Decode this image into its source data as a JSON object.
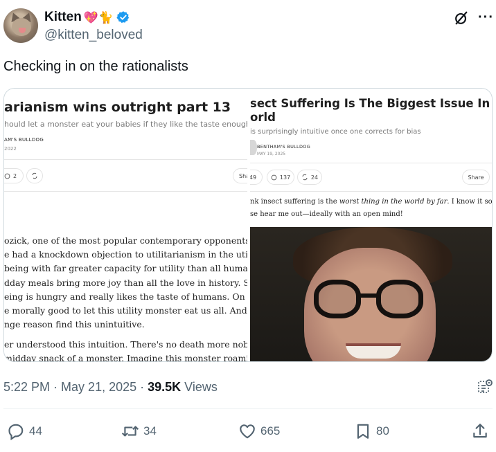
{
  "author": {
    "display_name": "Kitten",
    "emoji": "💖🐈",
    "handle": "@kitten_beloved"
  },
  "tweet": {
    "text": "Checking in on the rationalists"
  },
  "media": {
    "left": {
      "title": "arianism wins outright part 13",
      "subtitle": "hould let a monster eat your babies if they like the taste enough",
      "author": "AM'S BULLDOG",
      "date": "2022",
      "comment_count": "2",
      "share_label": "Sha",
      "body_lines": [
        "ozick, one of the most popular contemporary opponents of utilitaria",
        "e had a knockdown objection to utilitarianism in the utility monster",
        " being with far greater capacity for utility than all humans in history",
        "dday meals bring more joy than all the love in history. Suppose addi",
        "eing is hungry and really likes the taste of humans. On utilitarian a",
        "e morally good to let this utility monster eat us all. And yet some pe",
        "nge reason find this unintuitive.",
        "er understood this intuition. There's no death more noble than dyin",
        "midday snack of a monster. Imagine this monster roaming around, e"
      ]
    },
    "right": {
      "title_line1": "sect Suffering Is The Biggest Issue In The",
      "title_line2": "orld",
      "subtitle": "is surprisingly intuitive once one corrects for bias",
      "author": "BENTHAM'S BULLDOG",
      "date": "MAY 19, 2025",
      "likes": "49",
      "comments": "137",
      "restacks": "24",
      "share_label": "Share",
      "body_line1_pre": "nk insect suffering is the ",
      "body_line1_em": "worst thing in the world by far",
      "body_line1_post": ". I know it sounds weird!",
      "body_line2": "se hear me out—ideally with an open mind!"
    }
  },
  "meta": {
    "time": "5:22 PM",
    "separator": "·",
    "date": "May 21, 2025",
    "views_count": "39.5K",
    "views_label": "Views"
  },
  "actions": {
    "replies": "44",
    "reposts": "34",
    "likes": "665",
    "bookmarks": "80"
  },
  "colors": {
    "verified": "#1d9bf0",
    "secondary_text": "#536471",
    "primary_text": "#0f1419"
  },
  "icons": [
    "verified-badge-icon",
    "grok-icon",
    "more-icon",
    "analytics-icon",
    "reply-icon",
    "repost-icon",
    "like-icon",
    "bookmark-icon",
    "share-icon"
  ]
}
